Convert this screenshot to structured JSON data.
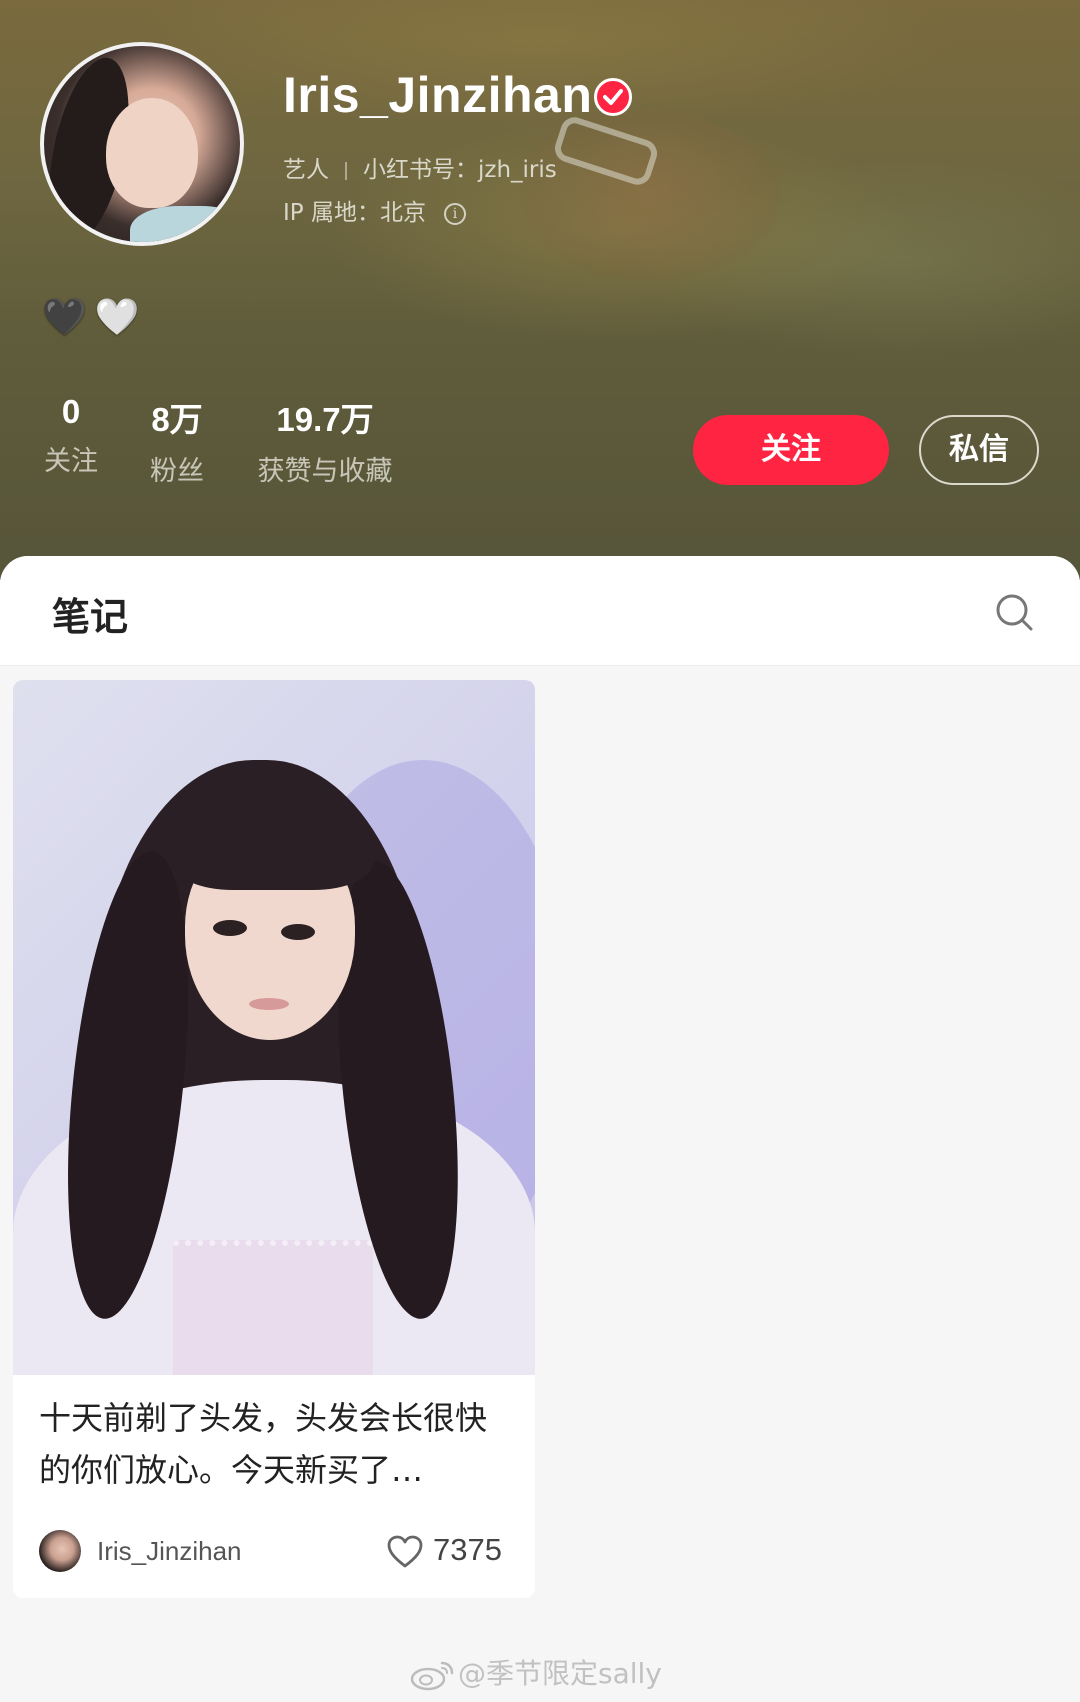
{
  "profile": {
    "username": "Iris_Jinzihan",
    "verified_icon": "verified-check-icon",
    "role": "艺人",
    "red_id_label": "小红书号：",
    "red_id": "jzh_iris",
    "ip_label": "IP 属地：",
    "ip_location": "北京",
    "info_icon": "info-icon",
    "bio_emojis": [
      "🖤",
      "🤍"
    ],
    "stats": [
      {
        "value": "0",
        "label": "关注"
      },
      {
        "value": "8万",
        "label": "粉丝"
      },
      {
        "value": "19.7万",
        "label": "获赞与收藏"
      }
    ],
    "follow_label": "关注",
    "message_label": "私信",
    "accent_color": "#ff2442"
  },
  "notes": {
    "title": "笔记",
    "search_icon": "search-icon",
    "items": [
      {
        "text": "十天前剃了头发，头发会长很快的你们放心。今天新买了…",
        "author": "Iris_Jinzihan",
        "likes": "7375",
        "like_icon": "heart-outline-icon"
      }
    ]
  },
  "watermark": {
    "icon": "weibo-icon",
    "text": "@季节限定sally"
  }
}
